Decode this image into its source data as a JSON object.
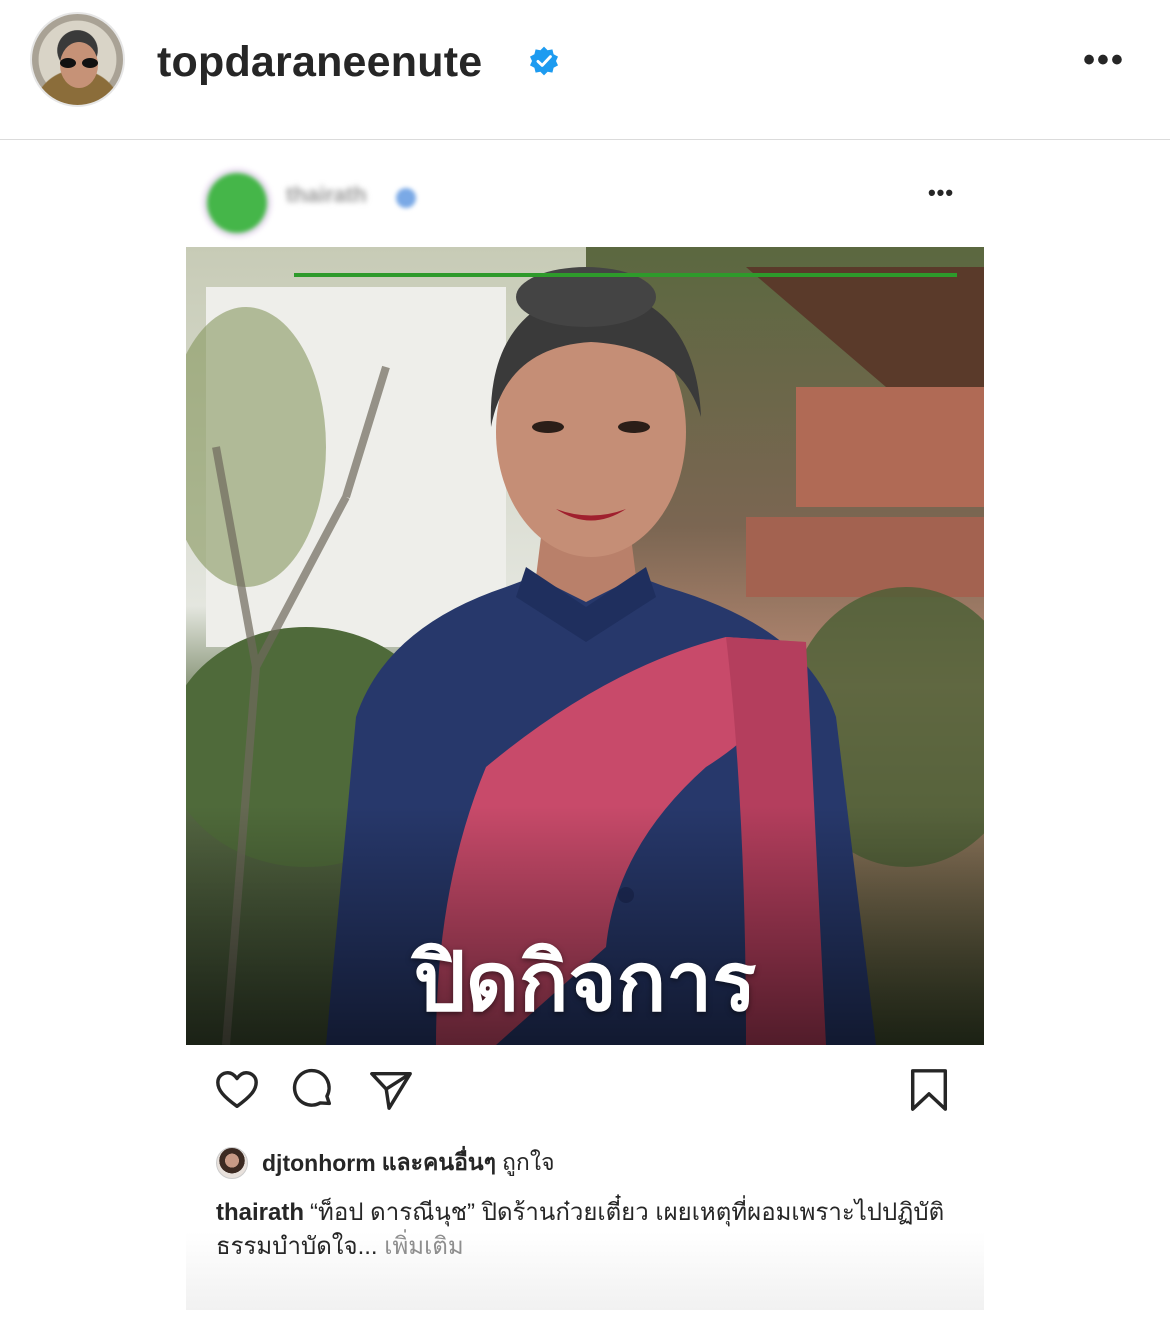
{
  "outer_post": {
    "username": "topdaraneenute",
    "verified_icon": "verified-badge-icon",
    "more_icon": "more-options-icon",
    "more_label": "•••"
  },
  "inner_post": {
    "username": "thairath",
    "more_label": "•••",
    "image_overlay_text": "ปิดกิจการ",
    "actions": {
      "like_icon": "heart-icon",
      "comment_icon": "comment-icon",
      "share_icon": "send-icon",
      "save_icon": "bookmark-icon"
    },
    "likes": {
      "liker": "djtonhorm",
      "and_others": "และคนอื่นๆ",
      "liked": "ถูกใจ"
    },
    "caption": {
      "username": "thairath",
      "text": "“ท็อป ดารณีนุช” ปิดร้านก๋วยเตี๋ยว เผยเหตุที่ผอมเพราะไปปฏิบัติธรรมบำบัดใจ...",
      "more": "เพิ่มเติม"
    }
  },
  "colors": {
    "verified_blue": "#1d9bf0",
    "text_dark": "#262626",
    "text_muted": "#8e8e8e",
    "brand_green": "#45b649"
  }
}
